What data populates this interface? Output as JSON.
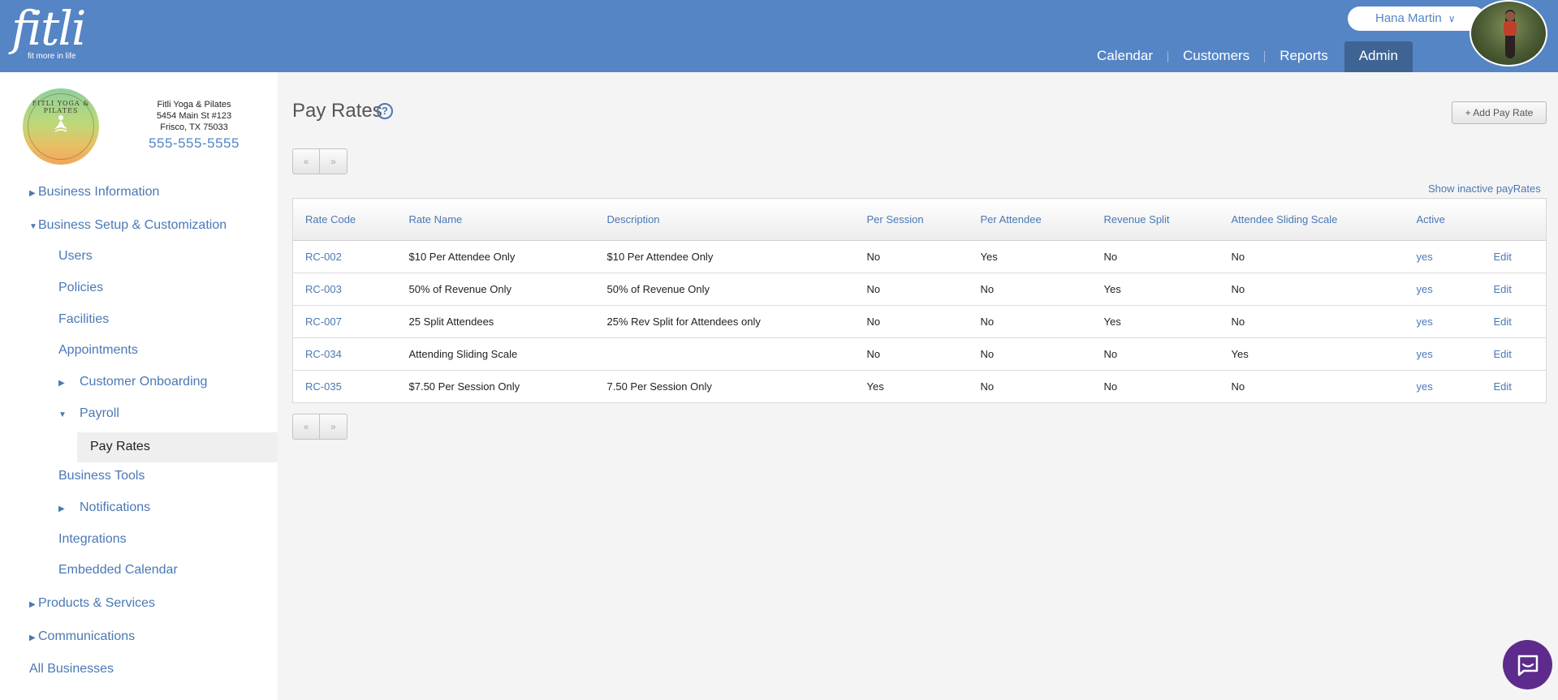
{
  "header": {
    "logo_word": "fitli",
    "logo_tagline": "fit more in life",
    "user_name": "Hana Martin",
    "nav": [
      "Calendar",
      "Customers",
      "Reports",
      "Admin"
    ],
    "active_nav": "Admin",
    "brand_color": "#5585c5"
  },
  "business": {
    "logo_text": "FITLI YOGA & PILATES",
    "name": "Fitli Yoga & Pilates",
    "address1": "5454 Main St #123",
    "address2": "Frisco, TX 75033",
    "phone": "555-555-5555"
  },
  "sidebar": {
    "business_information": "Business Information",
    "business_setup": "Business Setup & Customization",
    "users": "Users",
    "policies": "Policies",
    "facilities": "Facilities",
    "appointments": "Appointments",
    "customer_onboarding": "Customer Onboarding",
    "payroll": "Payroll",
    "pay_rates": "Pay Rates",
    "business_tools": "Business Tools",
    "notifications": "Notifications",
    "integrations": "Integrations",
    "embedded_calendar": "Embedded Calendar",
    "products_services": "Products & Services",
    "communications": "Communications",
    "all_businesses": "All Businesses"
  },
  "page": {
    "title": "Pay Rates",
    "help": "?",
    "add_button": "+ Add Pay Rate",
    "prev": "«",
    "next": "»",
    "show_inactive": "Show inactive payRates"
  },
  "table": {
    "columns": [
      "Rate Code",
      "Rate Name",
      "Description",
      "Per Session",
      "Per Attendee",
      "Revenue Split",
      "Attendee Sliding Scale",
      "Active",
      ""
    ],
    "rows": [
      [
        "RC-002",
        "$10 Per Attendee Only",
        "$10 Per Attendee Only",
        "No",
        "Yes",
        "No",
        "No",
        "yes",
        "Edit"
      ],
      [
        "RC-003",
        "50% of Revenue Only",
        "50% of Revenue Only",
        "No",
        "No",
        "Yes",
        "No",
        "yes",
        "Edit"
      ],
      [
        "RC-007",
        "25 Split Attendees",
        "25% Rev Split for Attendees only",
        "No",
        "No",
        "Yes",
        "No",
        "yes",
        "Edit"
      ],
      [
        "RC-034",
        "Attending Sliding Scale",
        "",
        "No",
        "No",
        "No",
        "Yes",
        "yes",
        "Edit"
      ],
      [
        "RC-035",
        "$7.50 Per Session Only",
        "7.50 Per Session Only",
        "Yes",
        "No",
        "No",
        "No",
        "yes",
        "Edit"
      ]
    ]
  }
}
